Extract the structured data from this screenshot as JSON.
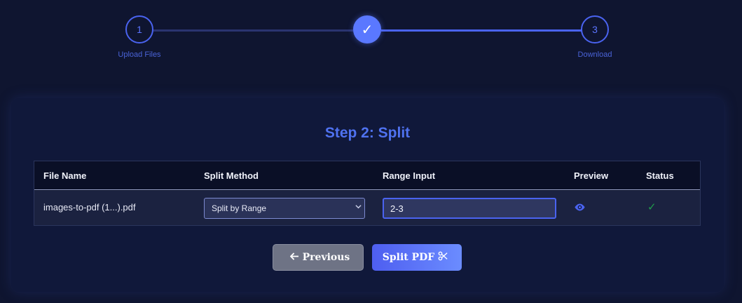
{
  "stepper": {
    "steps": [
      {
        "number": "1",
        "label": "Upload Files"
      },
      {
        "number": "✓",
        "label": ""
      },
      {
        "number": "3",
        "label": "Download"
      }
    ]
  },
  "card": {
    "title": "Step 2: Split",
    "table": {
      "headers": [
        "File Name",
        "Split Method",
        "Range Input",
        "Preview",
        "Status"
      ],
      "rows": [
        {
          "file_name": "images-to-pdf (1...).pdf",
          "split_method": "Split by Range",
          "range_input": "2-3",
          "preview_icon": "eye-icon",
          "status": "✓"
        }
      ]
    },
    "buttons": {
      "previous_label": "Previous",
      "split_label": "Split PDF"
    }
  },
  "colors": {
    "accent": "#4a63f0",
    "status_ok": "#1f9d4a",
    "background": "#0f1530"
  }
}
